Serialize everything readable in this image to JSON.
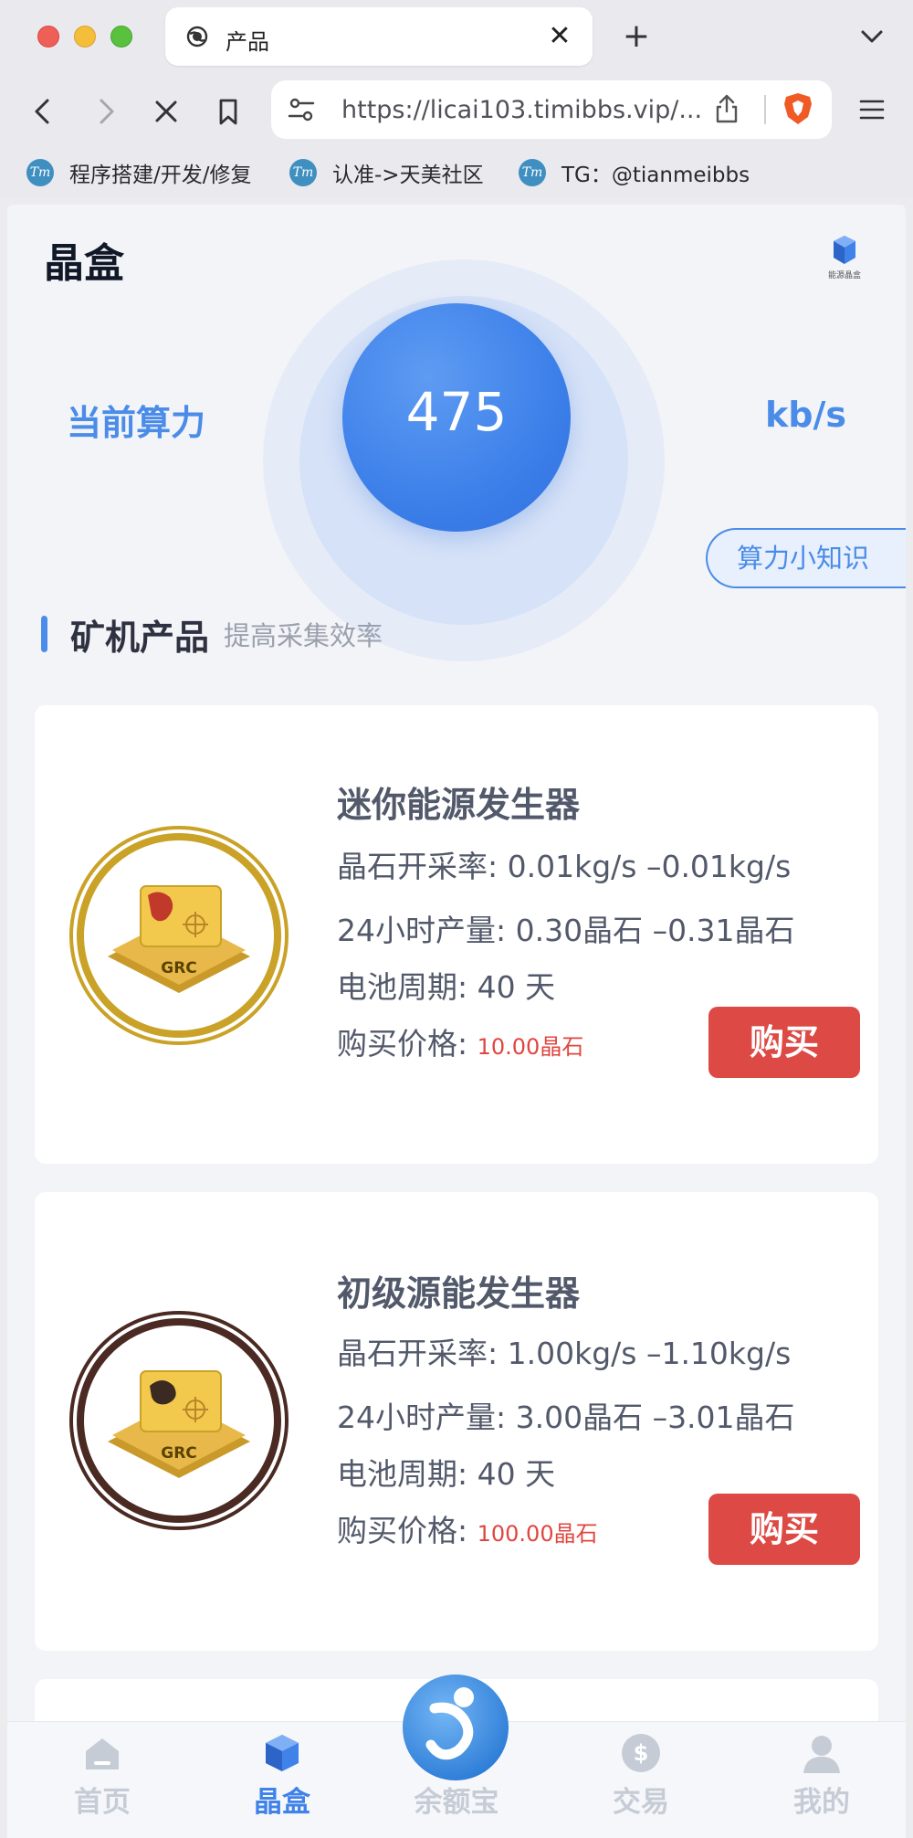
{
  "browser": {
    "tab_title": "产品",
    "tab_close": "✕",
    "new_tab": "+",
    "url": "https://licai103.timibbs.vip/...",
    "bookmarks": [
      {
        "label": "程序搭建/开发/修复",
        "icon_text": "Tm"
      },
      {
        "label": "认准->天美社区",
        "icon_text": "Tm"
      },
      {
        "label": "TG：@tianmeibbs",
        "icon_text": "Tm"
      }
    ]
  },
  "page": {
    "title": "晶盒",
    "logo_text": "能源晶盒",
    "power": {
      "label": "当前算力",
      "value": "475",
      "unit": "kb/s"
    },
    "knowledge_button": "算力小知识",
    "section": {
      "title": "矿机产品",
      "subtitle": "提高采集效率"
    },
    "products": [
      {
        "name": "迷你能源发生器",
        "rate": "晶石开采率: 0.01kg/s –0.01kg/s",
        "output": "24小时产量: 0.30晶石 –0.31晶石",
        "battery": "电池周期: 40 天",
        "price_label": "购买价格: ",
        "price_value": "10.00晶石",
        "buy": "购买",
        "badge_text": "GRC",
        "ring_color": "#c9a227"
      },
      {
        "name": "初级源能发生器",
        "rate": "晶石开采率: 1.00kg/s –1.10kg/s",
        "output": "24小时产量: 3.00晶石 –3.01晶石",
        "battery": "电池周期: 40 天",
        "price_label": "购买价格: ",
        "price_value": "100.00晶石",
        "buy": "购买",
        "badge_text": "GRC",
        "ring_color": "#4a2a22"
      }
    ]
  },
  "nav": {
    "items": [
      {
        "label": "首页",
        "icon": "home-icon"
      },
      {
        "label": "晶盒",
        "icon": "cube-icon",
        "active": true
      },
      {
        "label": "余额宝",
        "icon": "wallet-logo-icon"
      },
      {
        "label": "交易",
        "icon": "dollar-icon"
      },
      {
        "label": "我的",
        "icon": "user-icon"
      }
    ]
  },
  "colors": {
    "accent": "#4a8ce8",
    "buy": "#dd4944",
    "price": "#e0463f"
  }
}
